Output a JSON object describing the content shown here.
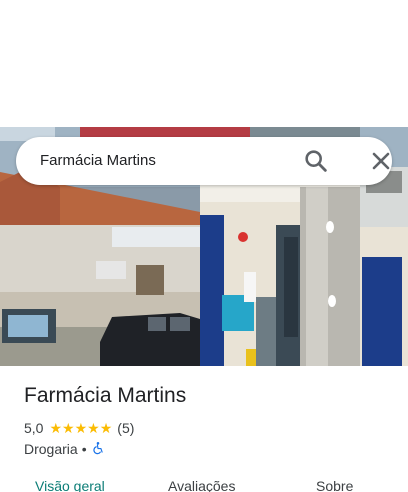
{
  "search": {
    "query": "Farmácia Martins"
  },
  "icons": {
    "search": "search-icon",
    "close": "close-icon",
    "accessibility": "wheelchair-accessible-icon"
  },
  "place": {
    "title": "Farmácia Martins",
    "rating": "5,0",
    "stars": 5,
    "review_count": "(5)",
    "category": "Drogaria",
    "separator": "•"
  },
  "tabs": {
    "overview": "Visão geral",
    "reviews": "Avaliações",
    "about": "Sobre"
  },
  "colors": {
    "active_tab": "#0b7d76",
    "star": "#fbbc04",
    "accessibility_icon": "#1a73e8"
  }
}
